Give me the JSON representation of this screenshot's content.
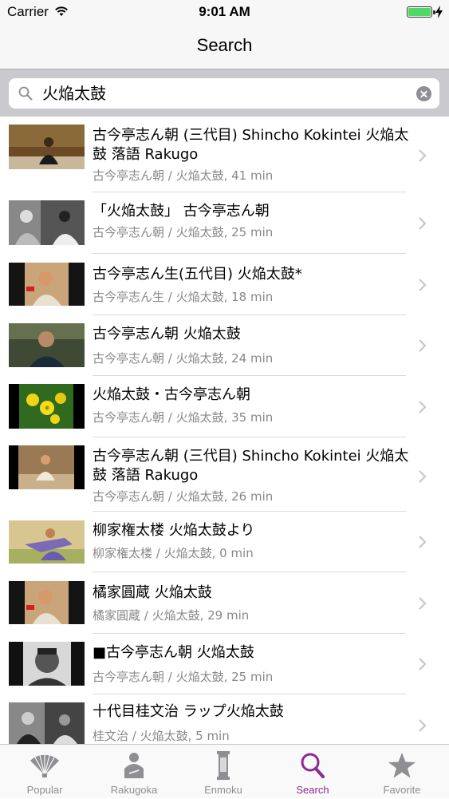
{
  "status_bar": {
    "carrier": "Carrier",
    "time": "9:01 AM"
  },
  "nav": {
    "title": "Search"
  },
  "search": {
    "query": "火焔太鼓"
  },
  "results": [
    {
      "title": "古今亭志ん朝 (三代目) Shincho Kokintei 火焔太鼓 落語 Rakugo",
      "subtitle": "古今亭志ん朝 / 火焔太鼓, 41 min"
    },
    {
      "title": "「火焔太鼓」 古今亭志ん朝",
      "subtitle": "古今亭志ん朝 / 火焔太鼓, 25 min"
    },
    {
      "title": "古今亭志ん生(五代目) 火焔太鼓*",
      "subtitle": "古今亭志ん生 / 火焔太鼓, 18 min"
    },
    {
      "title": "古今亭志ん朝 火焔太鼓",
      "subtitle": "古今亭志ん朝 / 火焔太鼓, 24 min"
    },
    {
      "title": "火焔太鼓・古今亭志ん朝",
      "subtitle": "古今亭志ん朝 / 火焔太鼓, 35 min"
    },
    {
      "title": "古今亭志ん朝 (三代目) Shincho Kokintei 火焔太鼓 落語 Rakugo",
      "subtitle": "古今亭志ん朝 / 火焔太鼓, 26 min"
    },
    {
      "title": "柳家権太楼 火焔太鼓より",
      "subtitle": "柳家権太楼 / 火焔太鼓, 0 min"
    },
    {
      "title": "橘家圓蔵 火焔太鼓",
      "subtitle": "橘家圓蔵 / 火焔太鼓, 29 min"
    },
    {
      "title": "■古今亭志ん朝 火焔太鼓",
      "subtitle": "古今亭志ん朝 / 火焔太鼓, 25 min"
    },
    {
      "title": "十代目桂文治 ラップ火焔太鼓",
      "subtitle": "桂文治 / 火焔太鼓, 5 min"
    }
  ],
  "tabs": [
    {
      "label": "Popular",
      "icon": "fan-icon"
    },
    {
      "label": "Rakugoka",
      "icon": "person-icon"
    },
    {
      "label": "Enmoku",
      "icon": "scroll-icon"
    },
    {
      "label": "Search",
      "icon": "search-icon",
      "active": true
    },
    {
      "label": "Favorite",
      "icon": "star-icon"
    }
  ],
  "colors": {
    "accent": "#8e2a8d",
    "battery": "#4cd964",
    "inactive": "#8e8e93"
  }
}
